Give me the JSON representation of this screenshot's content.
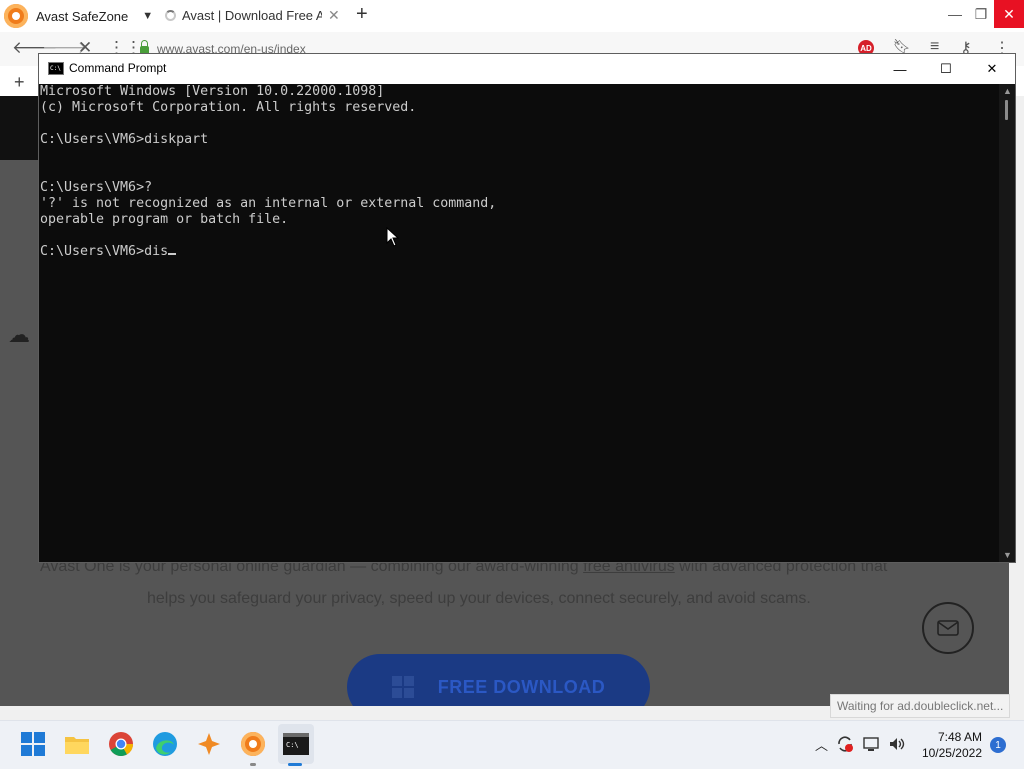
{
  "browser": {
    "app_title": "Avast SafeZone",
    "tab_title": "Avast | Download Free Ant",
    "url": "www.avast.com/en-us/index",
    "ad_badge": "AD"
  },
  "page": {
    "text_line1_pre": "Avast One is your personal online guardian — combining our award-winning ",
    "text_line1_link": "free antivirus",
    "text_line1_post": " with advanced protection that",
    "text_line2": "helps you safeguard your privacy, speed up your devices, connect securely, and avoid scams.",
    "download_label": "FREE DOWNLOAD",
    "status_text": "Waiting for ad.doubleclick.net..."
  },
  "cmd": {
    "title": "Command Prompt",
    "icon_text": "C:\\",
    "lines": [
      "Microsoft Windows [Version 10.0.22000.1098]",
      "(c) Microsoft Corporation. All rights reserved.",
      "",
      "C:\\Users\\VM6>diskpart",
      "",
      "",
      "C:\\Users\\VM6>?",
      "'?' is not recognized as an internal or external command,",
      "operable program or batch file.",
      "",
      "C:\\Users\\VM6>dis"
    ]
  },
  "taskbar": {
    "apps": [
      "start",
      "file-explorer",
      "chrome",
      "edge",
      "avast-secure-browser",
      "avast-safezone",
      "command-prompt"
    ],
    "time": "7:48 AM",
    "date": "10/25/2022",
    "notification_count": "1"
  },
  "colors": {
    "cmd_bg": "#0c0c0c",
    "cmd_text": "#cccccc",
    "page_overlay": "#555555",
    "download_button": "#1b3a84"
  }
}
